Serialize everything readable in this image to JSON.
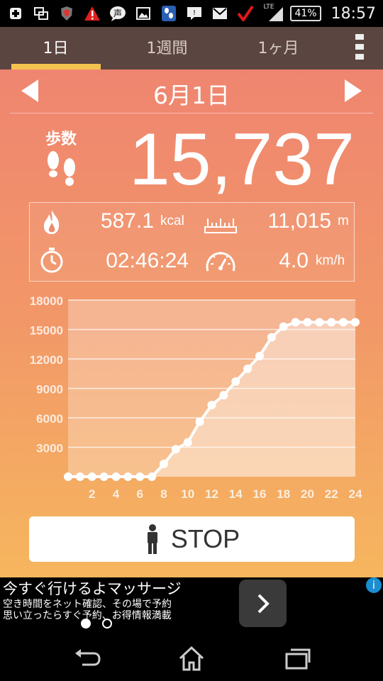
{
  "status_bar": {
    "time": "18:57",
    "battery": "41%",
    "network": "LTE",
    "icons": [
      "plus-icon",
      "screen-icon",
      "shield-icon",
      "warning-icon",
      "chat-voice-icon",
      "image-icon",
      "app-icon",
      "message-icon",
      "mail-icon",
      "check-icon"
    ]
  },
  "tabs": [
    {
      "label": "1日",
      "active": true
    },
    {
      "label": "1週間",
      "active": false
    },
    {
      "label": "1ヶ月",
      "active": false
    }
  ],
  "date": "6月1日",
  "steps": {
    "label": "歩数",
    "value": "15,737"
  },
  "stats": {
    "calories": {
      "value": "587.1",
      "unit": "kcal"
    },
    "distance": {
      "value": "11,015",
      "unit": "m"
    },
    "time": {
      "value": "02:46:24"
    },
    "speed": {
      "value": "4.0",
      "unit": "km/h"
    }
  },
  "chart_data": {
    "type": "area",
    "x": [
      0,
      1,
      2,
      3,
      4,
      5,
      6,
      7,
      8,
      9,
      10,
      11,
      12,
      13,
      14,
      15,
      16,
      17,
      18,
      19,
      20,
      21,
      22,
      23,
      24
    ],
    "values": [
      0,
      0,
      0,
      0,
      0,
      0,
      0,
      0,
      1300,
      2800,
      3500,
      5600,
      7300,
      8300,
      9700,
      11000,
      12300,
      14200,
      15300,
      15737,
      15737,
      15737,
      15737,
      15737,
      15737
    ],
    "xticks": [
      "2",
      "4",
      "6",
      "8",
      "10",
      "12",
      "14",
      "16",
      "18",
      "20",
      "22",
      "24"
    ],
    "yticks": [
      "18000",
      "15000",
      "12000",
      "9000",
      "6000",
      "3000"
    ],
    "ylim": [
      0,
      18000
    ],
    "xlim": [
      0,
      24
    ],
    "grid": true
  },
  "stop_button": {
    "label": "STOP"
  },
  "ad": {
    "title": "今すぐ行けるよマッサージ",
    "line1": "空き時間をネット確認、その場で予約",
    "line2": "思い立ったらすぐ予約、お得情報満載"
  },
  "colors": {
    "tab_bar": "#5b4540",
    "tab_indicator": "#f3c250",
    "gradient_top": "#ef8570",
    "gradient_bottom": "#f6b65e",
    "ad_info": "#1a8ed0"
  }
}
